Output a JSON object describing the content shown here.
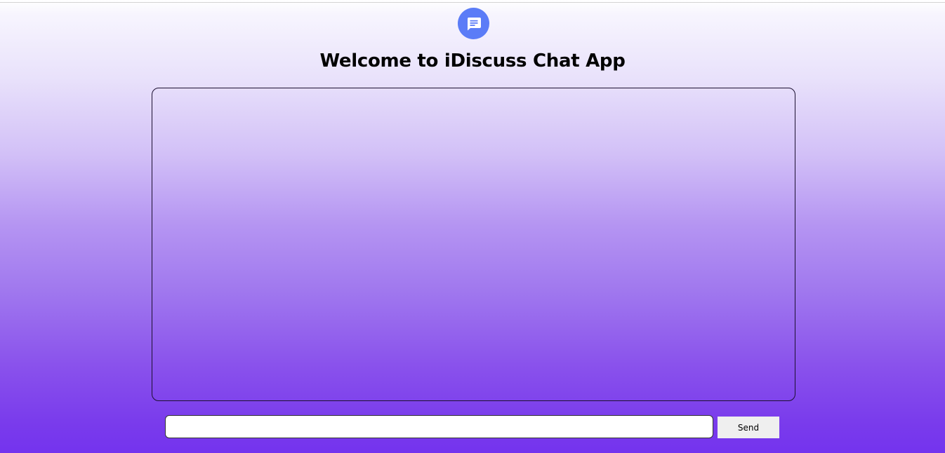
{
  "app": {
    "title": "Welcome to iDiscuss Chat App",
    "logo_icon": "chat-message-icon",
    "brand_color": "#5b7cf7"
  },
  "chat": {
    "messages": []
  },
  "composer": {
    "input_value": "",
    "input_placeholder": "",
    "send_label": "Send"
  },
  "theme": {
    "gradient_top": "#ffffff",
    "gradient_bottom": "#7433ee"
  }
}
